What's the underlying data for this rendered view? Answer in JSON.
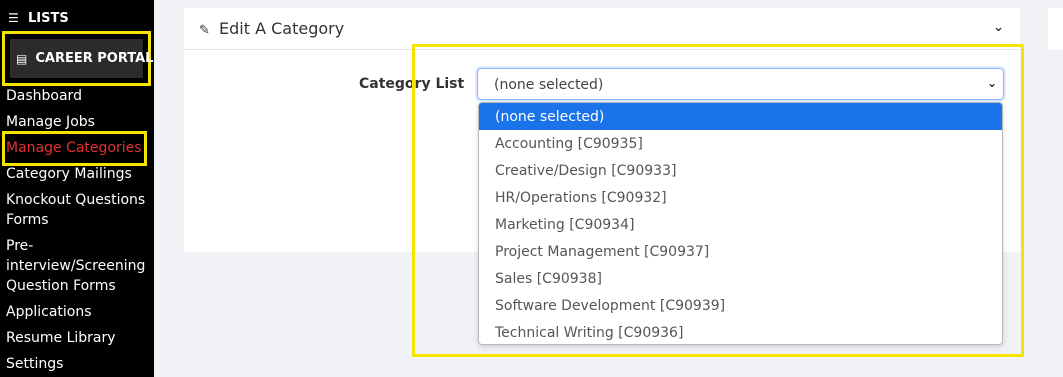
{
  "sidebar": {
    "lists_label": "LISTS",
    "portal_label": "CAREER PORTAL",
    "items": [
      {
        "label": "Dashboard"
      },
      {
        "label": "Manage Jobs"
      },
      {
        "label": "Manage Categories"
      },
      {
        "label": "Category Mailings"
      },
      {
        "label": "Knockout Questions"
      },
      {
        "label": "Forms"
      },
      {
        "label": "Pre-"
      },
      {
        "label": "interview/Screening"
      },
      {
        "label": "Question Forms"
      },
      {
        "label": "Applications"
      },
      {
        "label": "Resume Library"
      },
      {
        "label": "Settings"
      }
    ]
  },
  "card": {
    "title": "Edit A Category",
    "field_label": "Category List",
    "select_value": "(none selected)"
  },
  "dropdown": {
    "options": [
      "(none selected)",
      "Accounting [C90935]",
      "Creative/Design [C90933]",
      "HR/Operations [C90932]",
      "Marketing [C90934]",
      "Project Management [C90937]",
      "Sales [C90938]",
      "Software Development [C90939]",
      "Technical Writing [C90936]"
    ],
    "selected_index": 0
  },
  "colors": {
    "highlight": "#f5e400",
    "active_nav": "#e03131",
    "selected_option": "#1a73e8"
  }
}
